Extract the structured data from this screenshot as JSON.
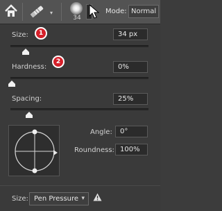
{
  "topbar": {
    "brush_size": "34",
    "mode_label": "Mode:",
    "mode_value": "Normal"
  },
  "panel": {
    "size": {
      "label": "Size:",
      "value": "34 px",
      "badge": "1",
      "slider_fraction": 0.1
    },
    "hardness": {
      "label": "Hardness:",
      "value": "0%",
      "badge": "2",
      "slider_fraction": 0.0
    },
    "spacing": {
      "label": "Spacing:",
      "value": "25%",
      "slider_fraction": 0.125
    },
    "angle": {
      "label": "Angle:",
      "value": "0°"
    },
    "roundness": {
      "label": "Roundness:",
      "value": "100%"
    },
    "size_control": {
      "label": "Size:",
      "value": "Pen Pressure"
    }
  },
  "colors": {
    "badge": "#d5202a",
    "panel": "#3a3a3a",
    "topbar": "#535353"
  },
  "icons": [
    "home-icon",
    "brush-tool-icon",
    "brush-preview-icon",
    "warning-icon",
    "chevron-down-icon"
  ]
}
